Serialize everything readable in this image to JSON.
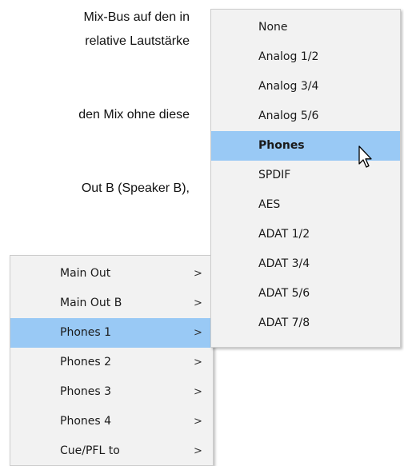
{
  "document": {
    "line_1": "Mix-Bus auf den in",
    "line_2": "relative  Lautstärke",
    "line_3": "den Mix ohne diese",
    "line_4": "Out B (Speaker B),"
  },
  "channel_menu": {
    "items": [
      {
        "label": "Main Out",
        "arrow": ">"
      },
      {
        "label": "Main Out B",
        "arrow": ">"
      },
      {
        "label": "Phones 1",
        "arrow": ">"
      },
      {
        "label": "Phones 2",
        "arrow": ">"
      },
      {
        "label": "Phones 3",
        "arrow": ">"
      },
      {
        "label": "Phones 4",
        "arrow": ">"
      },
      {
        "label": "Cue/PFL to",
        "arrow": ">"
      }
    ],
    "highlighted_index": 2
  },
  "output_menu": {
    "items": [
      {
        "label": "None"
      },
      {
        "label": "Analog 1/2"
      },
      {
        "label": "Analog 3/4"
      },
      {
        "label": "Analog 5/6"
      },
      {
        "label": "Phones"
      },
      {
        "label": "SPDIF"
      },
      {
        "label": "AES"
      },
      {
        "label": "ADAT 1/2"
      },
      {
        "label": "ADAT 3/4"
      },
      {
        "label": "ADAT 5/6"
      },
      {
        "label": "ADAT 7/8"
      }
    ],
    "highlighted_index": 4,
    "selected_label": "Phones"
  },
  "colors": {
    "menu_background": "#f2f2f2",
    "highlight": "#99c9f5",
    "menu_border": "#cccccc"
  },
  "icons": {
    "cursor": "arrow-cursor-icon",
    "submenu": "chevron-right-icon"
  }
}
